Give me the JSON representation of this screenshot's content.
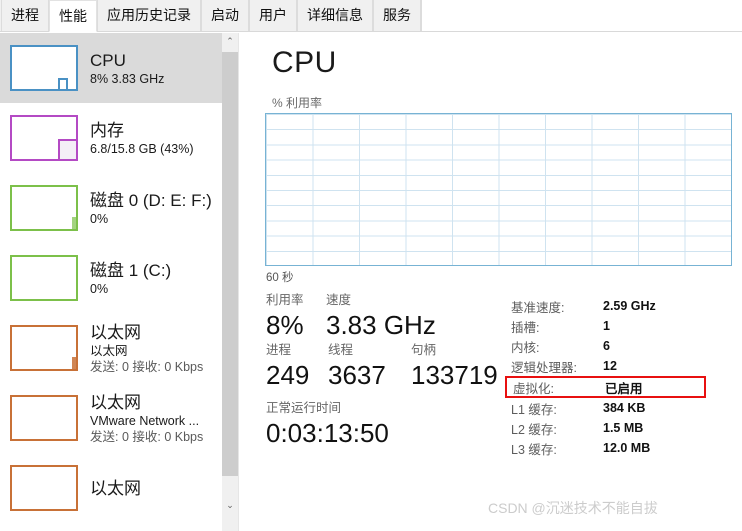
{
  "tabs": [
    {
      "label": "进程",
      "active": false
    },
    {
      "label": "性能",
      "active": true
    },
    {
      "label": "应用历史记录",
      "active": false
    },
    {
      "label": "启动",
      "active": false
    },
    {
      "label": "用户",
      "active": false
    },
    {
      "label": "详细信息",
      "active": false
    },
    {
      "label": "服务",
      "active": false
    }
  ],
  "sidebar": {
    "items": [
      {
        "title": "CPU",
        "sub1": "8%  3.83 GHz",
        "sub2": "",
        "color": "#4a91c4",
        "selected": true,
        "fill": 0
      },
      {
        "title": "内存",
        "sub1": "6.8/15.8 GB (43%)",
        "sub2": "",
        "color": "#b44ac4",
        "selected": false,
        "fill": 43
      },
      {
        "title": "磁盘 0 (D: E: F:)",
        "sub1": "0%",
        "sub2": "",
        "color": "#7cc04a",
        "selected": false,
        "fill": 0
      },
      {
        "title": "磁盘 1 (C:)",
        "sub1": "0%",
        "sub2": "",
        "color": "#7cc04a",
        "selected": false,
        "fill": 0
      },
      {
        "title": "以太网",
        "sub1": "以太网",
        "sub2": "发送: 0 接收: 0 Kbps",
        "color": "#c87137",
        "selected": false,
        "fill": 0
      },
      {
        "title": "以太网",
        "sub1": "VMware Network ...",
        "sub2": "发送: 0 接收: 0 Kbps",
        "color": "#c87137",
        "selected": false,
        "fill": 0
      },
      {
        "title": "以太网",
        "sub1": "",
        "sub2": "",
        "color": "#c87137",
        "selected": false,
        "fill": 0
      }
    ],
    "scrollbar": {
      "up_arrow": "⌃",
      "down_arrow": "⌄"
    }
  },
  "main": {
    "title": "CPU",
    "graph_label": "% 利用率",
    "graph_footer": "60 秒",
    "stats": {
      "utilization_label": "利用率",
      "utilization_value": "8%",
      "speed_label": "速度",
      "speed_value": "3.83 GHz",
      "processes_label": "进程",
      "processes_value": "249",
      "threads_label": "线程",
      "threads_value": "3637",
      "handles_label": "句柄",
      "handles_value": "133719",
      "uptime_label": "正常运行时间",
      "uptime_value": "0:03:13:50"
    },
    "details": [
      {
        "label": "基准速度:",
        "value": "2.59 GHz",
        "highlight": false
      },
      {
        "label": "插槽:",
        "value": "1",
        "highlight": false
      },
      {
        "label": "内核:",
        "value": "6",
        "highlight": false
      },
      {
        "label": "逻辑处理器:",
        "value": "12",
        "highlight": false
      },
      {
        "label": "虚拟化:",
        "value": "已启用",
        "highlight": true
      },
      {
        "label": "L1 缓存:",
        "value": "384 KB",
        "highlight": false
      },
      {
        "label": "L2 缓存:",
        "value": "1.5 MB",
        "highlight": false
      },
      {
        "label": "L3 缓存:",
        "value": "12.0 MB",
        "highlight": false
      }
    ]
  },
  "chart_data": {
    "type": "line",
    "title": "% 利用率",
    "xlabel": "60 秒",
    "ylabel": "% 利用率",
    "ylim": [
      0,
      100
    ],
    "xlim": [
      0,
      60
    ],
    "grid": true,
    "legend": "none",
    "series": [
      {
        "name": "CPU 利用率",
        "values": []
      }
    ]
  },
  "watermark": "CSDN @沉迷技术不能自拔",
  "colors": {
    "cpu": "#4a91c4",
    "memory": "#b44ac4",
    "disk": "#7cc04a",
    "ethernet": "#c87137",
    "highlight": "#e81010",
    "selection": "#dadada"
  }
}
